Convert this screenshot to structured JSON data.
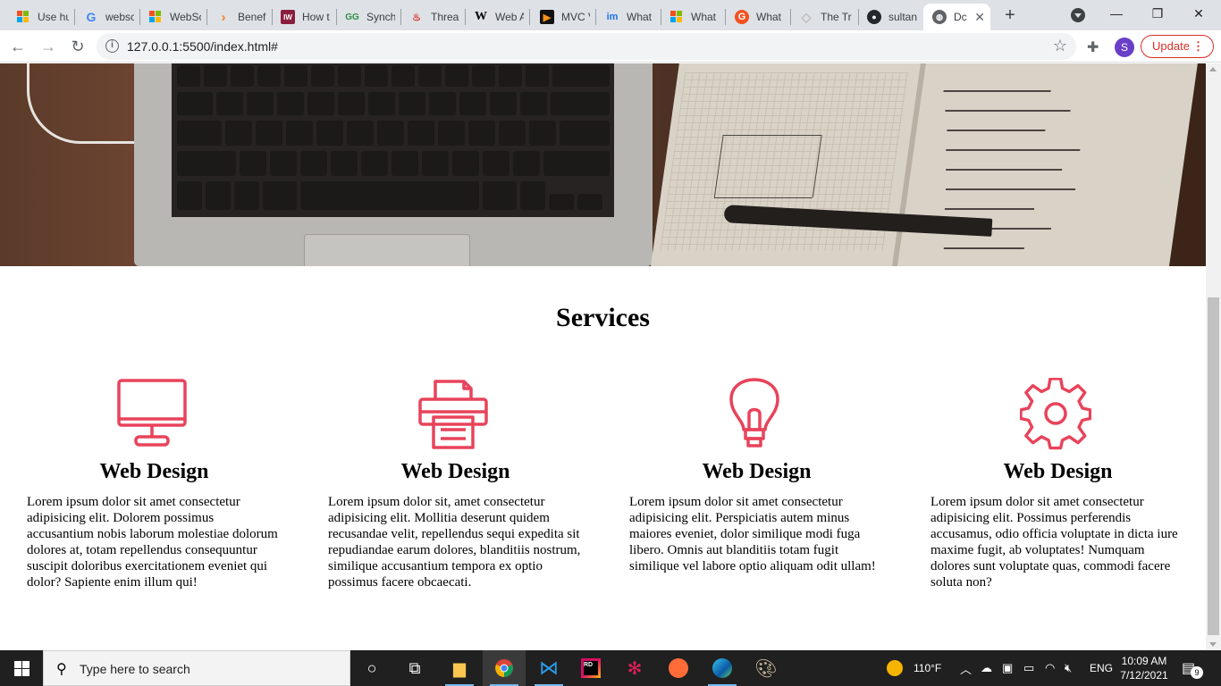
{
  "browser": {
    "tabs": [
      {
        "title": "Use hu",
        "favicon": "microsoft-icon",
        "color": "#f25022"
      },
      {
        "title": "websc",
        "favicon": "google-icon",
        "color": "#4285f4"
      },
      {
        "title": "WebSc",
        "favicon": "microsoft-icon",
        "color": "#7fba00"
      },
      {
        "title": "Benefi",
        "favicon": "chevron-logo-icon",
        "color": "#f48024"
      },
      {
        "title": "How t",
        "favicon": "iw-logo-icon",
        "color": "#8b1e3f"
      },
      {
        "title": "Synchi",
        "favicon": "gfg-logo-icon",
        "color": "#2f8d46"
      },
      {
        "title": "Threac",
        "favicon": "flame-icon",
        "color": "#d93025"
      },
      {
        "title": "Web A",
        "favicon": "wikipedia-icon",
        "color": "#000000"
      },
      {
        "title": "MVC V",
        "favicon": "play-logo-icon",
        "color": "#f7931e"
      },
      {
        "title": "What",
        "favicon": "im-logo-icon",
        "color": "#1a73e8"
      },
      {
        "title": "What",
        "favicon": "microsoft-icon",
        "color": "#00a4ef"
      },
      {
        "title": "What",
        "favicon": "g-circle-icon",
        "color": "#f4511e"
      },
      {
        "title": "The Tr",
        "favicon": "diamond-icon",
        "color": "#bdbdbd"
      },
      {
        "title": "sultan",
        "favicon": "github-icon",
        "color": "#24292e"
      },
      {
        "title": "Dc",
        "favicon": "globe-icon",
        "color": "#5f6368",
        "active": true
      }
    ],
    "new_tab": "+",
    "window_controls": {
      "minimize": "—",
      "maximize": "❐",
      "close": "✕"
    },
    "url": "127.0.0.1:5500/index.html#",
    "profile_initial": "S",
    "update_label": "Update"
  },
  "page": {
    "services_title": "Services",
    "services": [
      {
        "icon": "monitor-icon",
        "title": "Web Design",
        "text": "Lorem ipsum dolor sit amet consectetur adipisicing elit. Dolorem possimus accusantium nobis laborum molestiae dolorum dolores at, totam repellendus consequuntur suscipit doloribus exercitationem eveniet qui dolor? Sapiente enim illum qui!"
      },
      {
        "icon": "printer-icon",
        "title": "Web Design",
        "text": "Lorem ipsum dolor sit, amet consectetur adipisicing elit. Mollitia deserunt quidem recusandae velit, repellendus sequi expedita sit repudiandae earum dolores, blanditiis nostrum, similique accusantium tempora ex optio possimus facere obcaecati."
      },
      {
        "icon": "lightbulb-icon",
        "title": "Web Design",
        "text": "Lorem ipsum dolor sit amet consectetur adipisicing elit. Perspiciatis autem minus maiores eveniet, dolor similique modi fuga libero. Omnis aut blanditiis totam fugit similique vel labore optio aliquam odit ullam!"
      },
      {
        "icon": "gear-icon",
        "title": "Web Design",
        "text": "Lorem ipsum dolor sit amet consectetur adipisicing elit. Possimus perferendis accusamus, odio officia voluptate in dicta iure maxime fugit, ab voluptates! Numquam dolores sunt voluptate quas, commodi facere soluta non?"
      }
    ],
    "accent_color": "#e8435a"
  },
  "taskbar": {
    "search_placeholder": "Type here to search",
    "pinned": [
      "task-view-icon",
      "file-explorer-icon",
      "chrome-icon",
      "vscode-icon",
      "rider-icon",
      "slack-icon",
      "postman-icon",
      "edge-icon",
      "paint-icon"
    ],
    "weather": "110°F",
    "language": "ENG",
    "time": "10:09 AM",
    "date": "7/12/2021",
    "notification_count": "9"
  }
}
